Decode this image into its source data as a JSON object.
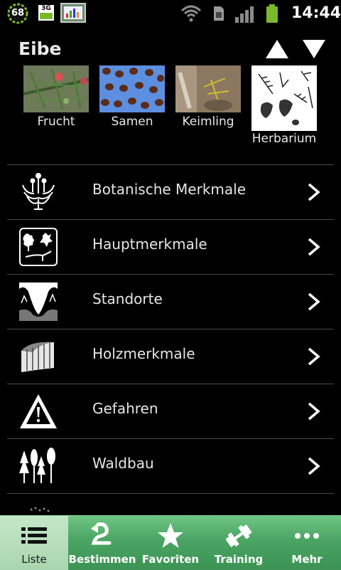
{
  "status_bar": {
    "battery_level": "68",
    "network_type": "3G",
    "time": "14:44"
  },
  "header": {
    "title": "Eibe"
  },
  "thumbnails": [
    {
      "label": "Frucht"
    },
    {
      "label": "Samen"
    },
    {
      "label": "Keimling"
    },
    {
      "label": "Herbarium"
    }
  ],
  "list": {
    "items": [
      {
        "label": "Botanische Merkmale",
        "icon": "flower-diagram-icon"
      },
      {
        "label": "Hauptmerkmale",
        "icon": "leaves-icon"
      },
      {
        "label": "Standorte",
        "icon": "terrain-icon"
      },
      {
        "label": "Holzmerkmale",
        "icon": "wood-log-icon"
      },
      {
        "label": "Gefahren",
        "icon": "warning-icon"
      },
      {
        "label": "Waldbau",
        "icon": "trees-icon"
      }
    ]
  },
  "tabbar": {
    "tabs": [
      {
        "label": "Liste",
        "icon": "list-icon",
        "active": true
      },
      {
        "label": "Bestimmen",
        "icon": "identify-icon",
        "active": false
      },
      {
        "label": "Favoriten",
        "icon": "star-icon",
        "active": false
      },
      {
        "label": "Training",
        "icon": "dumbbell-icon",
        "active": false
      },
      {
        "label": "Mehr",
        "icon": "more-icon",
        "active": false
      }
    ]
  },
  "colors": {
    "background": "#000000",
    "tabbar_green": "#4aa462",
    "tab_active": "#b6ddbb",
    "battery_ring": "#7ab82c"
  }
}
